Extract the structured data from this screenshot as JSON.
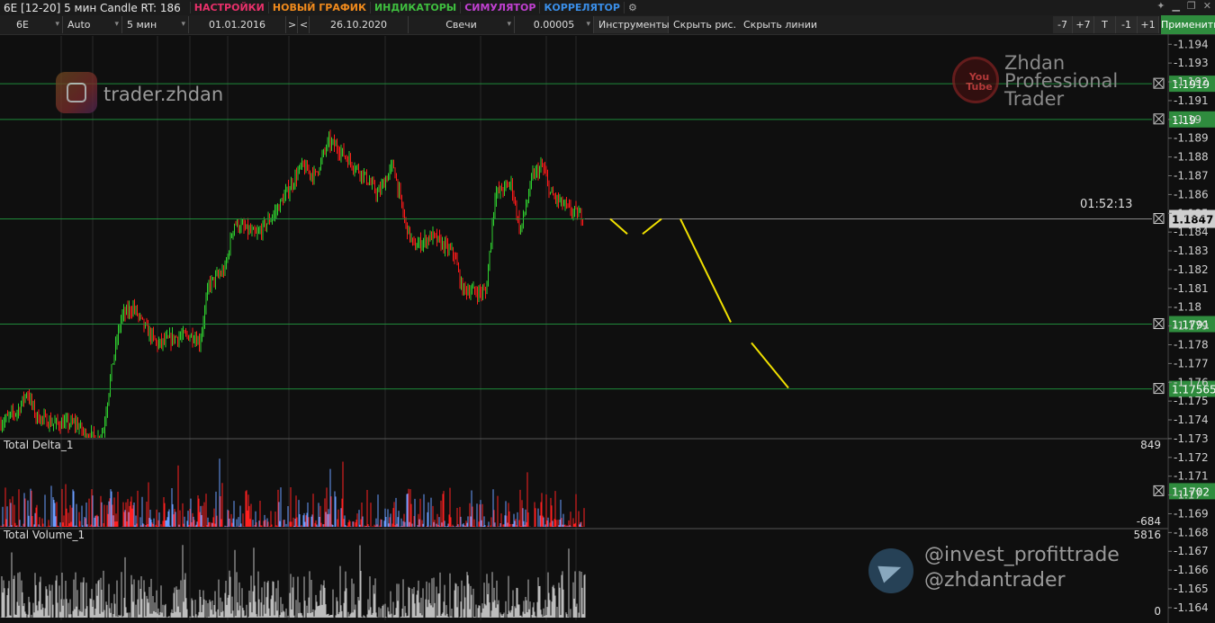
{
  "window": {
    "title": "6E [12-20] 5 мин Candle RT: 186",
    "menus": [
      {
        "label": "НАСТРОЙКИ",
        "color": "#e8306a"
      },
      {
        "label": "НОВЫЙ ГРАФИК",
        "color": "#f08a1c"
      },
      {
        "label": "ИНДИКАТОРЫ",
        "color": "#3fbf3f"
      },
      {
        "label": "СИМУЛЯТОР",
        "color": "#c040d0"
      },
      {
        "label": "КОРРЕЛЯТОР",
        "color": "#3a8ee8"
      }
    ]
  },
  "toolbar": {
    "symbol": "6E",
    "scale": "Auto",
    "timeframe": "5 мин",
    "date_from": "01.01.2016",
    "nav_next": ">",
    "nav_prev": "<",
    "date_to": "26.10.2020",
    "chart_type": "Свечи",
    "tick": "0.00005",
    "instruments": "Инструменты",
    "hide_drawings": "Скрыть рис.",
    "hide_lines": "Скрыть линии",
    "buttons": [
      "-7",
      "+7",
      "T",
      "-1",
      "+1"
    ],
    "apply": "Применить"
  },
  "colors": {
    "bull": "#2fcf2f",
    "bear": "#ff1a1a",
    "level_line": "#1f8a3a",
    "level_label_bg": "#2f8c3e",
    "current_label_bg": "#cfcfcf",
    "drawing": "#f0e000",
    "delta_pos": "#6a9cff",
    "delta_neg": "#ff2020",
    "volume": "#bdbdbd"
  },
  "watermarks": {
    "instagram": "trader.zhdan",
    "youtube_line1": "Zhdan",
    "youtube_line2": "Professional",
    "youtube_line3": "Trader",
    "youtube_icon": "You Tube",
    "telegram_line1": "@invest_profittrade",
    "telegram_line2": "@zhdantrader"
  },
  "timer": "01:52:13",
  "chart_data": {
    "type": "candlestick",
    "y_ticks": [
      -1.194,
      -1.193,
      -1.192,
      -1.191,
      -1.19,
      -1.189,
      -1.188,
      -1.187,
      -1.186,
      -1.185,
      -1.184,
      -1.183,
      -1.182,
      -1.181,
      -1.18,
      -1.179,
      -1.178,
      -1.177,
      -1.176,
      -1.175,
      -1.174,
      -1.173,
      -1.172,
      -1.171,
      -1.17,
      -1.169,
      -1.168,
      -1.167,
      -1.166,
      -1.165,
      -1.164
    ],
    "ylim": [
      1.1639,
      1.1943
    ],
    "price_path": [
      [
        0,
        1.1738
      ],
      [
        20,
        1.1745
      ],
      [
        30,
        1.1755
      ],
      [
        40,
        1.1742
      ],
      [
        60,
        1.1738
      ],
      [
        85,
        1.1738
      ],
      [
        95,
        1.1732
      ],
      [
        110,
        1.173
      ],
      [
        115,
        1.1735
      ],
      [
        125,
        1.177
      ],
      [
        135,
        1.1795
      ],
      [
        148,
        1.18
      ],
      [
        160,
        1.179
      ],
      [
        175,
        1.178
      ],
      [
        195,
        1.1784
      ],
      [
        215,
        1.1785
      ],
      [
        222,
        1.1781
      ],
      [
        232,
        1.1812
      ],
      [
        250,
        1.182
      ],
      [
        260,
        1.1845
      ],
      [
        285,
        1.1838
      ],
      [
        305,
        1.185
      ],
      [
        320,
        1.1862
      ],
      [
        335,
        1.1875
      ],
      [
        350,
        1.187
      ],
      [
        365,
        1.1888
      ],
      [
        375,
        1.1885
      ],
      [
        390,
        1.1877
      ],
      [
        405,
        1.187
      ],
      [
        420,
        1.186
      ],
      [
        437,
        1.1876
      ],
      [
        450,
        1.1845
      ],
      [
        460,
        1.1832
      ],
      [
        480,
        1.1838
      ],
      [
        505,
        1.1828
      ],
      [
        513,
        1.181
      ],
      [
        530,
        1.1808
      ],
      [
        540,
        1.1808
      ],
      [
        550,
        1.186
      ],
      [
        568,
        1.1866
      ],
      [
        578,
        1.184
      ],
      [
        592,
        1.187
      ],
      [
        603,
        1.1875
      ],
      [
        612,
        1.186
      ],
      [
        632,
        1.1852
      ],
      [
        648,
        1.1848
      ]
    ],
    "levels": [
      {
        "price": 1.1919,
        "label": "1.1919"
      },
      {
        "price": 1.19,
        "label": "1.19"
      },
      {
        "price": 1.17565,
        "label": "1.17565"
      },
      {
        "price": 1.1791,
        "label": "1.1791"
      },
      {
        "price": 1.1702,
        "label": "1.1702"
      }
    ],
    "current_price": {
      "price": 1.1847,
      "label": "1.1847"
    },
    "drawings": [
      {
        "from": [
          678,
          1.1847
        ],
        "to": [
          697,
          1.1839
        ]
      },
      {
        "from": [
          714,
          1.1839
        ],
        "to": [
          735,
          1.1847
        ]
      },
      {
        "from": [
          756,
          1.1847
        ],
        "to": [
          812,
          1.1792
        ]
      },
      {
        "from": [
          835,
          1.1781
        ],
        "to": [
          876,
          1.1757
        ]
      }
    ],
    "delta_panel": {
      "title": "Total Delta_1",
      "max_label": "849",
      "min_label": "-684",
      "max": 849,
      "min": -684
    },
    "volume_panel": {
      "title": "Total Volume_1",
      "max_label": "5816",
      "min_label": "0",
      "max": 5816,
      "min": 0
    }
  }
}
